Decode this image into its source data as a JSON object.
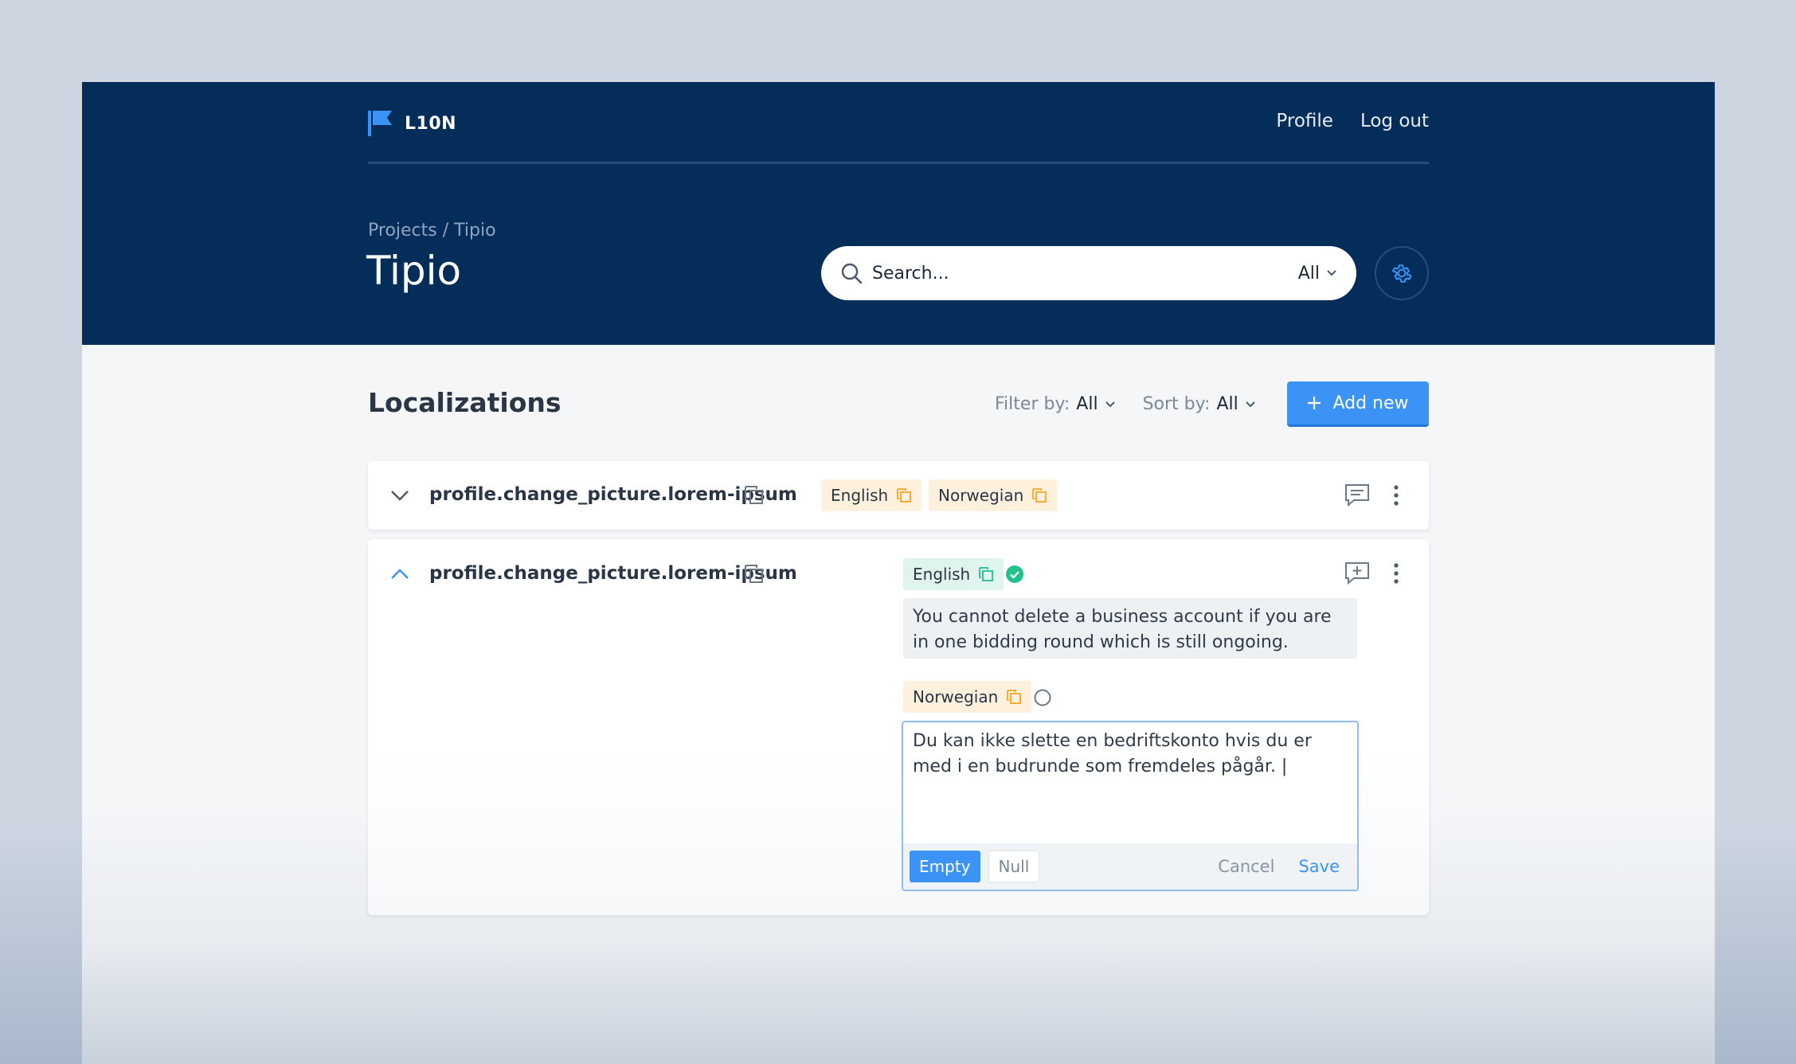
{
  "app": {
    "brand": "L10N",
    "colors": {
      "header_bg": "#052d5a",
      "accent": "#3b94f5",
      "success": "#1fc28b",
      "tag_orange": "#fdf0dc",
      "tag_green": "#dff4ec"
    }
  },
  "topnav": {
    "profile": "Profile",
    "logout": "Log out"
  },
  "breadcrumb": "Projects / Tipio",
  "page_title": "Tipio",
  "search": {
    "placeholder": "Search...",
    "scope": "All"
  },
  "section": {
    "title": "Localizations",
    "filter_label": "Filter by:",
    "filter_value": "All",
    "sort_label": "Sort by:",
    "sort_value": "All",
    "add_label": "Add new"
  },
  "rows": [
    {
      "key": "profile.change_picture.lorem-ipsum",
      "expanded": false,
      "languages": [
        "English",
        "Norwegian"
      ]
    },
    {
      "key": "profile.change_picture.lorem-ipsum",
      "expanded": true,
      "english": {
        "label": "English",
        "status": "done",
        "text": "You cannot delete a business account if you are in one bidding round which is still ongoing."
      },
      "norwegian": {
        "label": "Norwegian",
        "status": "pending",
        "value": "Du kan ikke slette en bedriftskonto hvis du er med i en budrunde som fremdeles pågår. |"
      },
      "editor": {
        "empty": "Empty",
        "null": "Null",
        "cancel": "Cancel",
        "save": "Save"
      }
    }
  ]
}
